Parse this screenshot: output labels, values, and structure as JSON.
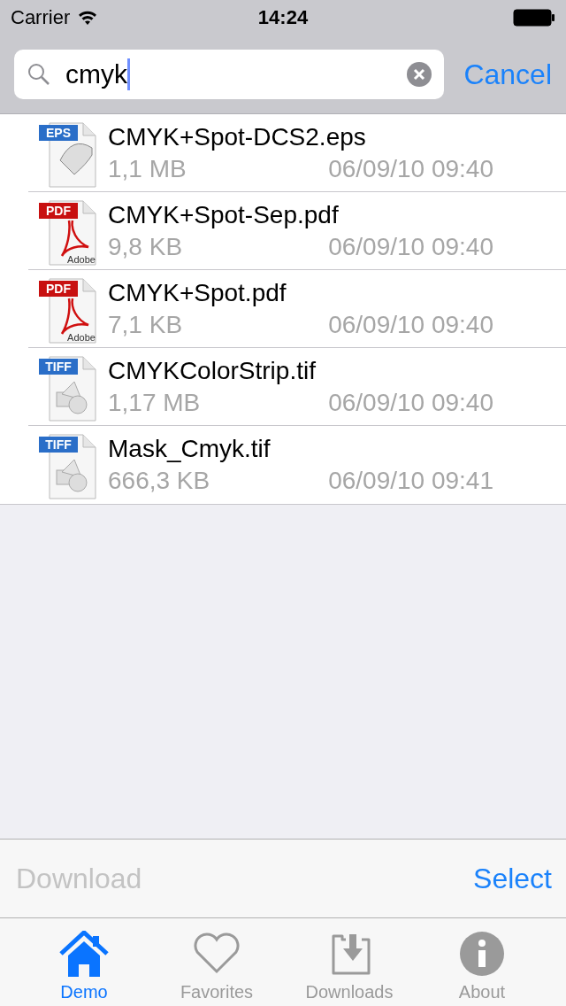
{
  "status_bar": {
    "carrier": "Carrier",
    "time": "14:24"
  },
  "search": {
    "value": "cmyk",
    "cancel": "Cancel"
  },
  "files": [
    {
      "kind": "eps",
      "badge": "EPS",
      "name": "CMYK+Spot-DCS2.eps",
      "size": "1,1 MB",
      "date": "06/09/10 09:40"
    },
    {
      "kind": "pdf",
      "badge": "PDF",
      "brand": "Adobe",
      "name": "CMYK+Spot-Sep.pdf",
      "size": "9,8 KB",
      "date": "06/09/10 09:40"
    },
    {
      "kind": "pdf",
      "badge": "PDF",
      "brand": "Adobe",
      "name": "CMYK+Spot.pdf",
      "size": "7,1 KB",
      "date": "06/09/10 09:40"
    },
    {
      "kind": "tiff",
      "badge": "TIFF",
      "name": "CMYKColorStrip.tif",
      "size": "1,17 MB",
      "date": "06/09/10 09:40"
    },
    {
      "kind": "tiff",
      "badge": "TIFF",
      "name": "Mask_Cmyk.tif",
      "size": "666,3 KB",
      "date": "06/09/10 09:41"
    }
  ],
  "toolbar": {
    "download": {
      "label": "Download",
      "disabled": true
    },
    "select": {
      "label": "Select",
      "disabled": false
    }
  },
  "tabs": [
    {
      "kind": "home",
      "label": "Demo",
      "selected": true
    },
    {
      "kind": "heart",
      "label": "Favorites",
      "selected": false
    },
    {
      "kind": "download",
      "label": "Downloads",
      "selected": false
    },
    {
      "kind": "info",
      "label": "About",
      "selected": false
    }
  ]
}
